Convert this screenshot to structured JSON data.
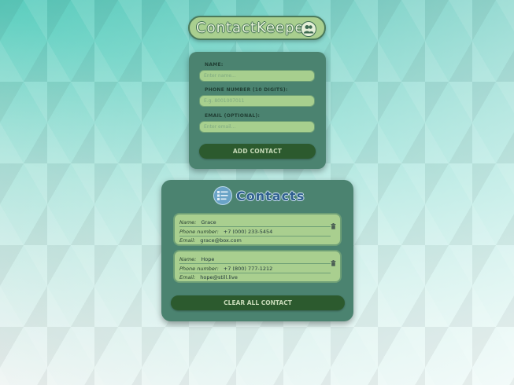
{
  "app": {
    "title": "ContactKeeper",
    "title_icon": "users-icon"
  },
  "form": {
    "name_label": "NAME:",
    "name_placeholder": "Enter name...",
    "name_value": "",
    "phone_label": "PHONE NUMBER (10 DIGITS):",
    "phone_placeholder": "E.g. 8001007011",
    "phone_value": "",
    "email_label": "EMAIL (OPTIONAL):",
    "email_placeholder": "Enter email...",
    "email_value": "",
    "add_button": "ADD CONTACT"
  },
  "contacts": {
    "title": "Contacts",
    "title_icon": "contact-list-icon",
    "labels": {
      "name": "Name:",
      "phone": "Phone number:",
      "email": "Email:"
    },
    "items": [
      {
        "name": "Grace",
        "phone": "+7 (000) 233-5454",
        "email": "grace@box.com"
      },
      {
        "name": "Hope",
        "phone": "+7 (800) 777-1212",
        "email": "hope@still.live"
      }
    ],
    "clear_button": "CLEAR ALL CONTACT"
  },
  "colors": {
    "card": "#4b8370",
    "field": "#a7cf8e",
    "button": "#2c5a2e",
    "title_blue": "#2f5f8f"
  }
}
